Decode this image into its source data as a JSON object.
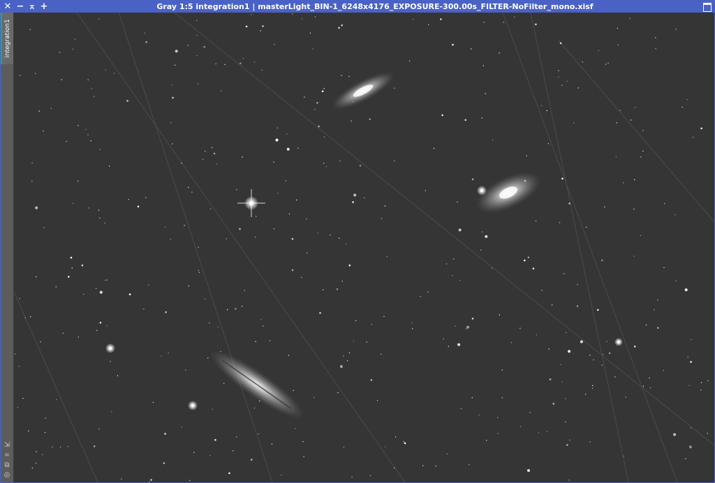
{
  "window": {
    "title": "Gray 1:5 integration1 | masterLight_BIN-1_6248x4176_EXPOSURE-300.00s_FILTER-NoFilter_mono.xisf",
    "buttons": {
      "close": "✕",
      "minimize": "−",
      "shade": "⌅",
      "zoom": "+"
    }
  },
  "sidebar": {
    "view_tab_label": "integration1",
    "icons": [
      "link-icon",
      "fit-icon",
      "clone-icon",
      "settings-icon"
    ]
  },
  "colors": {
    "titlebar": "#4a62c6",
    "tab_accent": "#1faf5a",
    "sky": "#353535"
  }
}
